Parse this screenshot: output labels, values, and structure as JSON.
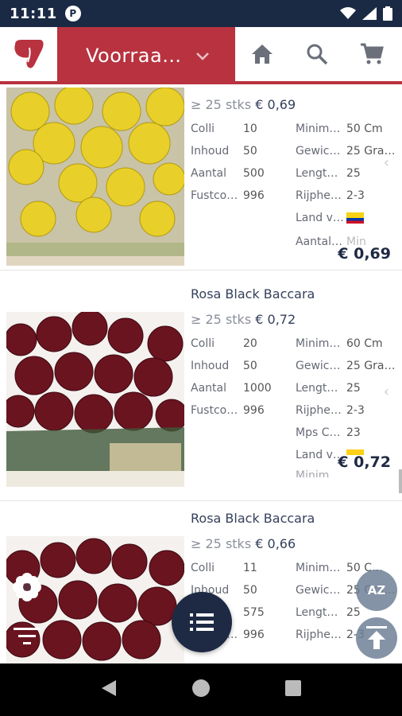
{
  "status": {
    "time": "11:11",
    "notif_icon": "P"
  },
  "header": {
    "title": "Voorraa…"
  },
  "products": [
    {
      "name": "",
      "tier": "≥ 25 stks",
      "tier_price": "€ 0,69",
      "specs_left": [
        {
          "k": "Colli",
          "v": "10"
        },
        {
          "k": "Inhoud",
          "v": "50"
        },
        {
          "k": "Aantal",
          "v": "500"
        },
        {
          "k": "Fustco…",
          "v": "996"
        }
      ],
      "specs_right": [
        {
          "k": "Minim…",
          "v": "50 Cm"
        },
        {
          "k": "Gewic…",
          "v": "25 Gra…"
        },
        {
          "k": "Lengt…",
          "v": "25"
        },
        {
          "k": "Rijphe…",
          "v": "2-3"
        },
        {
          "k": "Land v…",
          "v": ""
        },
        {
          "k": "Aantal…",
          "v": "Min"
        }
      ],
      "price": "€ 0,69",
      "flower_color": "#e8cf2a"
    },
    {
      "name": "Rosa Black Baccara",
      "tier": "≥ 25 stks",
      "tier_price": "€ 0,72",
      "specs_left": [
        {
          "k": "Colli",
          "v": "20"
        },
        {
          "k": "Inhoud",
          "v": "50"
        },
        {
          "k": "Aantal",
          "v": "1000"
        },
        {
          "k": "Fustco…",
          "v": "996"
        }
      ],
      "specs_right": [
        {
          "k": "Minim…",
          "v": "60 Cm"
        },
        {
          "k": "Gewic…",
          "v": "25 Gra…"
        },
        {
          "k": "Lengt…",
          "v": "25"
        },
        {
          "k": "Rijphe…",
          "v": "2-3"
        },
        {
          "k": "Mps C…",
          "v": "23"
        },
        {
          "k": "Land v…",
          "v": ""
        },
        {
          "k": "Minim…",
          "v": ""
        }
      ],
      "price": "€ 0,72",
      "flower_color": "#6a1420"
    },
    {
      "name": "Rosa Black Baccara",
      "tier": "≥ 25 stks",
      "tier_price": "€ 0,66",
      "specs_left": [
        {
          "k": "Colli",
          "v": "11"
        },
        {
          "k": "Inhoud",
          "v": "50"
        },
        {
          "k": "Aantal",
          "v": "575"
        },
        {
          "k": "Fustco…",
          "v": "996"
        }
      ],
      "specs_right": [
        {
          "k": "Minim…",
          "v": "50 C…"
        },
        {
          "k": "Gewic…",
          "v": "25 Gra…"
        },
        {
          "k": "Lengt…",
          "v": "25"
        },
        {
          "k": "Rijphe…",
          "v": "2-3"
        }
      ],
      "price": "",
      "flower_color": "#6a1420"
    }
  ],
  "fab": {
    "sort_label": "AZ"
  },
  "icons": {
    "home": "home-icon",
    "search": "search-icon",
    "cart": "cart-icon",
    "list": "list-icon",
    "flower": "flower-icon",
    "filter": "filter-icon",
    "top": "scroll-top-icon"
  },
  "colors": {
    "brand": "#b8323f",
    "dark": "#1e2a44",
    "statusbar": "#1a2a44"
  }
}
